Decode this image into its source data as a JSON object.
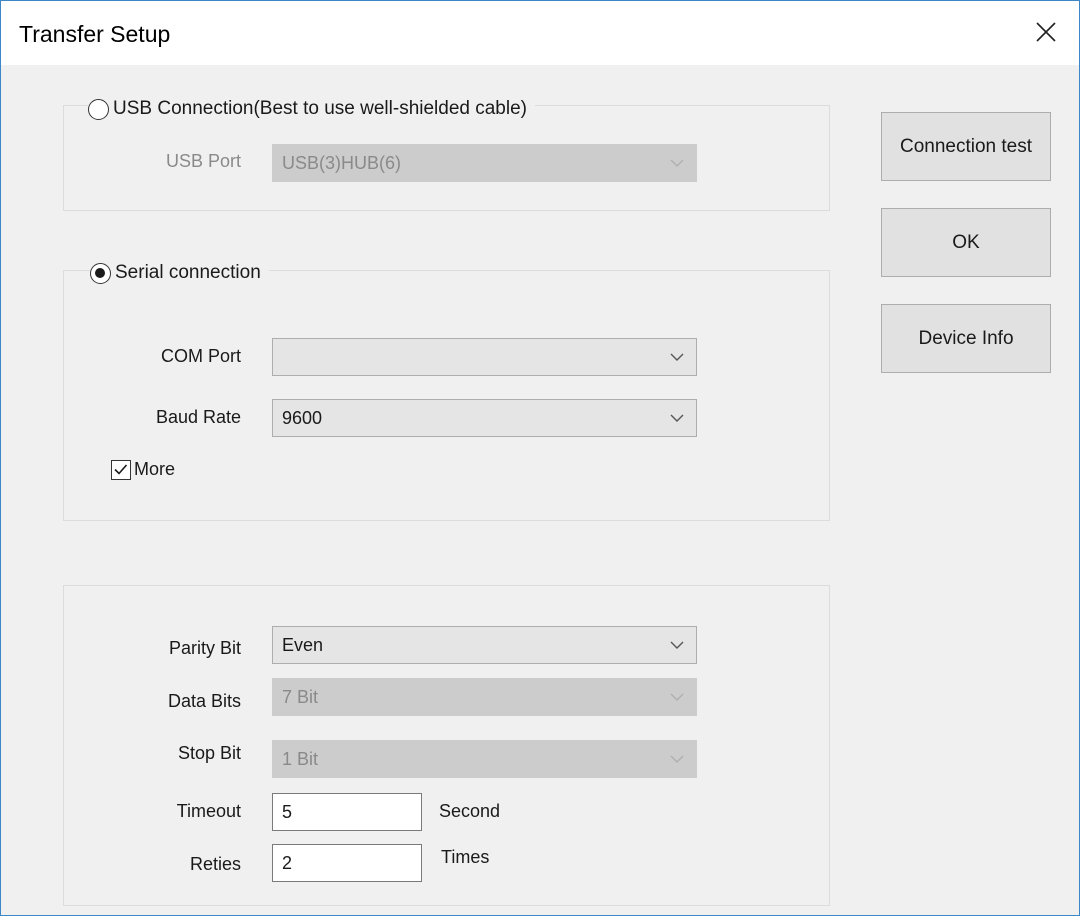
{
  "window": {
    "title": "Transfer Setup"
  },
  "usb": {
    "option_label": "USB Connection(Best to use well-shielded cable)",
    "selected": false,
    "port_label": "USB Port",
    "port_value": "USB(3)HUB(6)"
  },
  "serial": {
    "option_label": "Serial connection",
    "selected": true,
    "com_port_label": "COM Port",
    "com_port_value": "",
    "baud_rate_label": "Baud Rate",
    "baud_rate_value": "9600",
    "more_label": "More",
    "more_checked": true
  },
  "advanced": {
    "parity_label": "Parity Bit",
    "parity_value": "Even",
    "data_bits_label": "Data Bits",
    "data_bits_value": "7 Bit",
    "stop_bit_label": "Stop Bit",
    "stop_bit_value": "1 Bit",
    "timeout_label": "Timeout",
    "timeout_value": "5",
    "timeout_unit": "Second",
    "retries_label": "Reties",
    "retries_value": "2",
    "retries_unit": "Times"
  },
  "buttons": {
    "connection_test": "Connection test",
    "ok": "OK",
    "device_info": "Device Info"
  },
  "icons": {
    "close": "close-icon",
    "dropdown": "chevron-down-icon",
    "check": "checkmark-icon"
  },
  "colors": {
    "window_border": "#3c87c8",
    "dialog_bg": "#f0f0f0",
    "disabled_field": "#cccccc"
  }
}
